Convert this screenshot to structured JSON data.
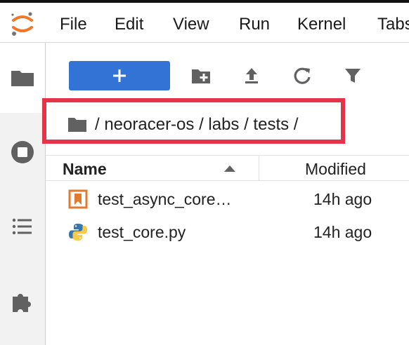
{
  "menu": {
    "items": [
      "File",
      "Edit",
      "View",
      "Run",
      "Kernel",
      "Tabs"
    ]
  },
  "sidebar": {
    "icons": [
      "folder-icon",
      "stop-circle-icon",
      "toc-list-icon",
      "extension-puzzle-icon"
    ]
  },
  "toolbar": {
    "new_label": "+",
    "icons": [
      "new-folder-icon",
      "upload-icon",
      "refresh-icon",
      "filter-icon"
    ]
  },
  "breadcrumb": {
    "path": "/ neoracer-os / labs / tests /"
  },
  "file_list": {
    "headers": {
      "name": "Name",
      "modified": "Modified"
    },
    "rows": [
      {
        "name": "test_async_core…",
        "modified": "14h ago",
        "icon": "notebook-icon"
      },
      {
        "name": "test_core.py",
        "modified": "14h ago",
        "icon": "python-file-icon"
      }
    ]
  },
  "colors": {
    "accent": "#3373d6",
    "highlight": "#e5334a",
    "notebook": "#e07a2e",
    "python_blue": "#3776ab",
    "python_yellow": "#f7c948"
  }
}
